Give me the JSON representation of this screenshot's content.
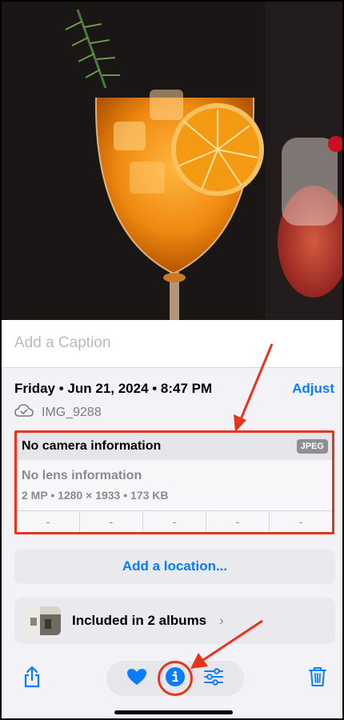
{
  "caption": {
    "placeholder": "Add a Caption"
  },
  "metadata": {
    "datetime": "Friday • Jun 21, 2024 • 8:47 PM",
    "adjust_label": "Adjust",
    "filename": "IMG_9288",
    "cloud_icon": "cloud-check-icon"
  },
  "camera_card": {
    "camera": "No camera information",
    "format_badge": "JPEG",
    "lens": "No lens information",
    "specs": "2 MP • 1280 × 1933 • 173 KB",
    "exif_values": [
      "-",
      "-",
      "-",
      "-",
      "-"
    ]
  },
  "location": {
    "label": "Add a location..."
  },
  "albums": {
    "label": "Included in 2 albums",
    "chevron": "›"
  },
  "toolbar": {
    "share_icon": "share-icon",
    "favorite_icon": "heart-icon",
    "info_icon": "info-icon",
    "edit_icon": "sliders-icon",
    "delete_icon": "trash-icon"
  },
  "colors": {
    "accent": "#0a7cff",
    "highlight": "#e8341c"
  }
}
